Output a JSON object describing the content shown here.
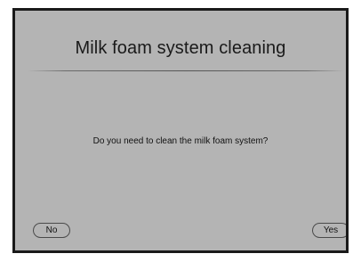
{
  "dialog": {
    "title": "Milk foam system cleaning",
    "message": "Do you need to clean the milk foam system?",
    "no_label": "No",
    "yes_label": "Yes"
  },
  "colors": {
    "background": "#b4b4b4",
    "border": "#1a1a1a",
    "text": "#111111"
  }
}
